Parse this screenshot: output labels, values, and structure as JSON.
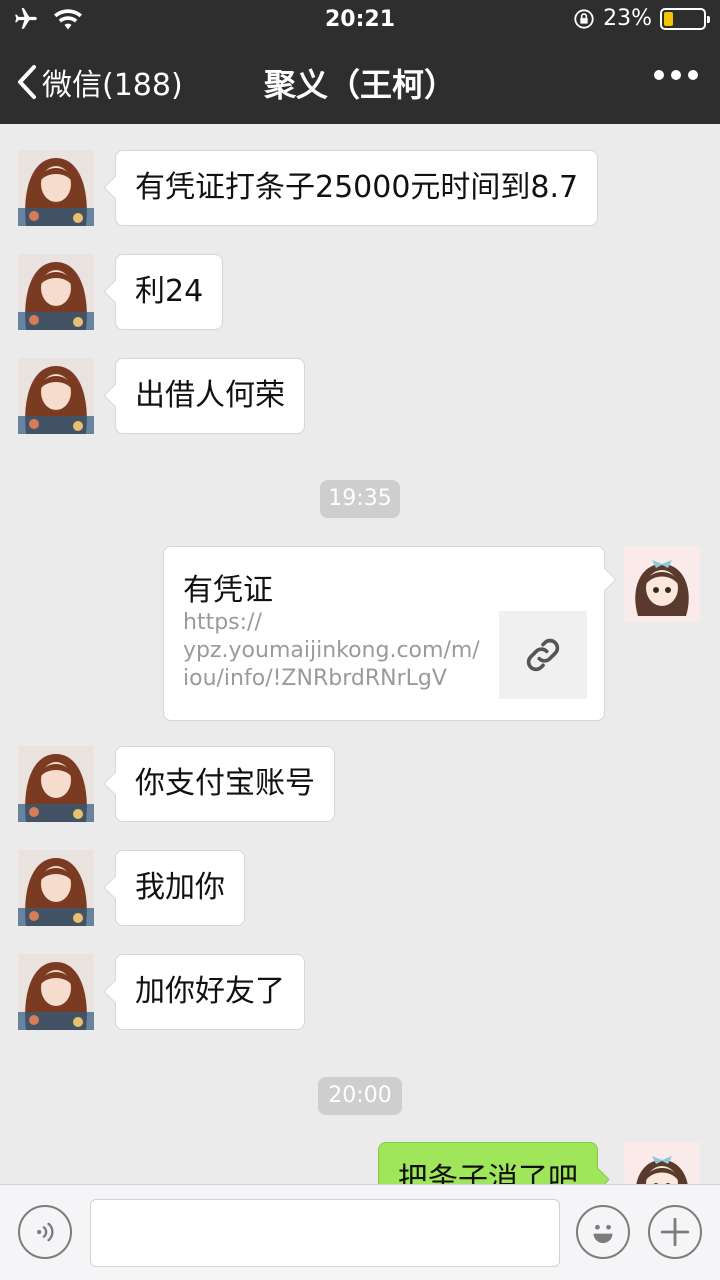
{
  "status_bar": {
    "time": "20:21",
    "battery_text": "23%",
    "battery_level": 0.23,
    "icons": [
      "airplane-icon",
      "wifi-icon",
      "rotation-lock-icon",
      "battery-icon"
    ]
  },
  "nav": {
    "back_label": "微信(188)",
    "title": "聚义（王柯）",
    "more_icon": "more-dots-icon"
  },
  "messages": [
    {
      "side": "left",
      "type": "text",
      "text": "有凭证打条子25000元时间到8.7"
    },
    {
      "side": "left",
      "type": "text",
      "text": "利24"
    },
    {
      "side": "left",
      "type": "text",
      "text": "出借人何荣"
    },
    {
      "type": "timestamp",
      "text": "19:35"
    },
    {
      "side": "right",
      "type": "link",
      "title": "有凭证",
      "url": "https://\nypz.youmaijinkong.com/m/\niou/info/!ZNRbrdRNrLgV",
      "thumb_icon": "link-icon"
    },
    {
      "side": "left",
      "type": "text",
      "text": "你支付宝账号"
    },
    {
      "side": "left",
      "type": "text",
      "text": "我加你"
    },
    {
      "side": "left",
      "type": "text",
      "text": "加你好友了"
    },
    {
      "type": "timestamp",
      "text": "20:00"
    },
    {
      "side": "right",
      "type": "text",
      "color": "green",
      "text": "把条子消了吧"
    }
  ],
  "input_bar": {
    "voice_icon": "voice-icon",
    "text_value": "",
    "emoji_icon": "emoji-icon",
    "plus_icon": "plus-icon"
  },
  "colors": {
    "bar_bg": "#2e2e2e",
    "chat_bg": "#ebebeb",
    "green_bubble": "#9fe65b",
    "battery_fill": "#f5c400"
  }
}
